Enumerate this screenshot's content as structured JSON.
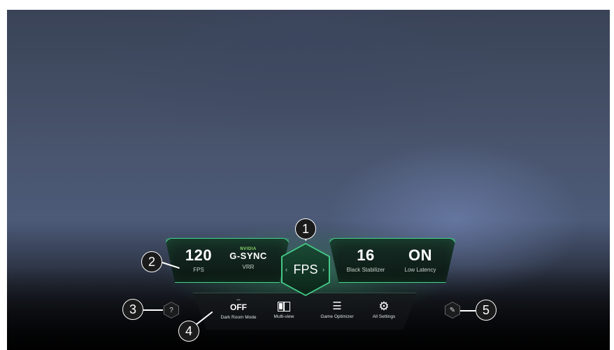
{
  "header": {
    "caption": ""
  },
  "game_dashboard": {
    "center_mode": {
      "label": "FPS"
    },
    "left_stats": [
      {
        "value": "120",
        "label": "FPS"
      },
      {
        "brand_top": "NVIDIA",
        "value": "G-SYNC",
        "label": "VRR"
      }
    ],
    "right_stats": [
      {
        "value": "16",
        "label": "Black Stabilizer"
      },
      {
        "value": "ON",
        "label": "Low Latency"
      }
    ],
    "bottom_bar": [
      {
        "value": "OFF",
        "label": "Dark Room Mode"
      },
      {
        "label": "Multi-view",
        "icon": "multiview-icon"
      },
      {
        "label": "Game Optimizer",
        "icon": "sliders-icon"
      },
      {
        "label": "All Settings",
        "icon": "gear-icon"
      }
    ],
    "help_icon": "?",
    "edit_icon": "✎"
  },
  "callouts": [
    "1",
    "2",
    "3",
    "4",
    "5"
  ],
  "colors": {
    "accent": "#43c985",
    "glow": "#3fd68a",
    "panel": "#0b2418"
  }
}
